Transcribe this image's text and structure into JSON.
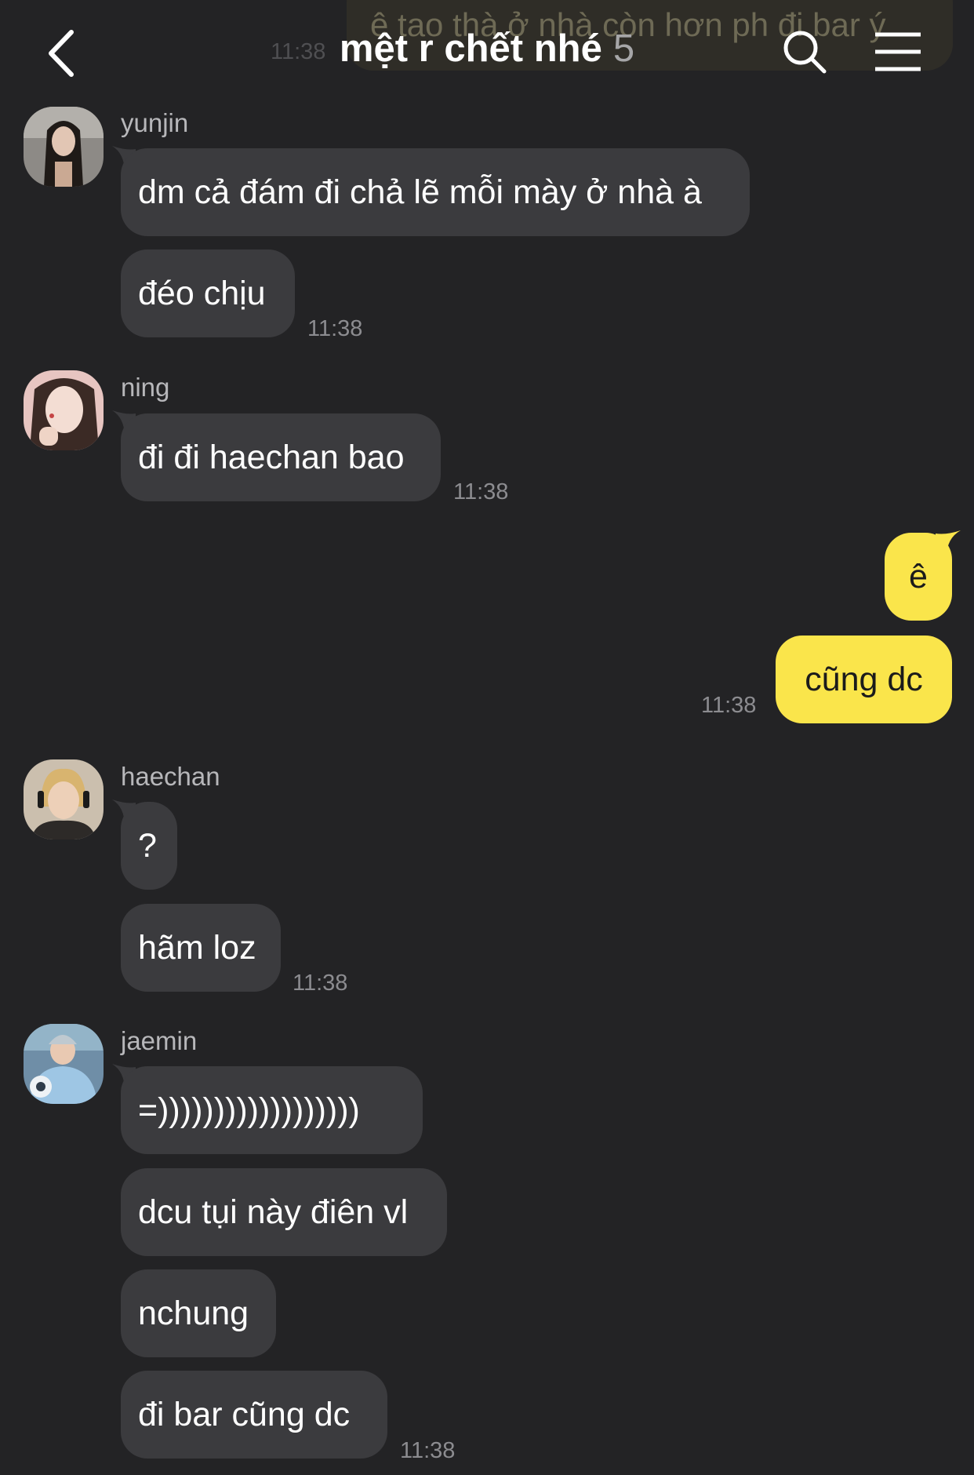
{
  "header": {
    "title": "mệt r chết nhé",
    "member_count": "5",
    "back_icon": "chevron-left-icon",
    "search_icon": "search-icon",
    "menu_icon": "hamburger-menu-icon"
  },
  "ghost": {
    "text": "ê tao thà ở nhà còn hơn ph đi bar ý",
    "time": "11:38"
  },
  "colors": {
    "background": "#232325",
    "incoming_bubble": "#3b3b3e",
    "outgoing_bubble": "#fae54b",
    "timestamp": "#8c8c90"
  },
  "groups": [
    {
      "sender": "yunjin",
      "messages": [
        "dm cả đám đi chả lẽ mỗi mày ở nhà à",
        "đéo chịu"
      ],
      "time": "11:38"
    },
    {
      "sender": "ning",
      "messages": [
        "đi đi haechan bao"
      ],
      "time": "11:38"
    },
    {
      "sender": "me",
      "messages": [
        "ê",
        "cũng dc"
      ],
      "time": "11:38"
    },
    {
      "sender": "haechan",
      "messages": [
        "?",
        "hãm loz"
      ],
      "time": "11:38"
    },
    {
      "sender": "jaemin",
      "messages": [
        "=))))))))))))))))))",
        "dcu tụi này điên vl",
        "nchung",
        "đi bar cũng dc"
      ],
      "time": "11:38"
    }
  ]
}
